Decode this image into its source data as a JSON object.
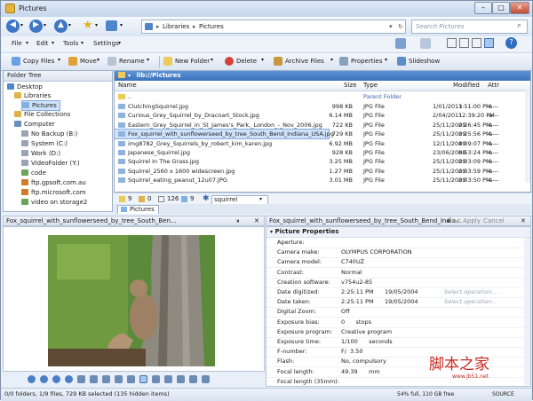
{
  "window": {
    "title": "Pictures",
    "minimize": "–",
    "maximize": "□",
    "close": "✕"
  },
  "nav": {
    "address": [
      "Libraries",
      "Pictures"
    ],
    "search_placeholder": "Search Pictures"
  },
  "menu": [
    "File",
    "Edit",
    "Tools",
    "Settings"
  ],
  "toolbar": [
    "Copy Files",
    "Move",
    "Rename",
    "New Folder",
    "Delete",
    "Archive Files",
    "Properties",
    "Slideshow"
  ],
  "folder_tree": {
    "header": "Folder Tree",
    "items": [
      "Desktop",
      "Libraries",
      "Pictures",
      "File Collections",
      "Computer",
      "No Backup (B:)",
      "System (C:)",
      "Work (D:)",
      "VideoFolder (Y:)",
      "code",
      "ftp.gpsoft.com.au",
      "ftp.microsoft.com",
      "video on storage2"
    ]
  },
  "lister": {
    "path": "lib://Pictures",
    "columns": {
      "name": "Name",
      "size": "Size",
      "type": "Type",
      "modified": "Modified",
      "attr": "Attr"
    },
    "parent": {
      "name": "..",
      "type": "Parent Folder"
    },
    "files": [
      {
        "name": "ClutchingSquirrel.jpg",
        "size": "998 KB",
        "type": "JPG File",
        "date": "1/01/2011",
        "time": "3:51:00 PM",
        "attr": "-a---"
      },
      {
        "name": "Curious_Grey_Squirrel_by_Dracoart_Stock.jpg",
        "size": "6.14 MB",
        "type": "JPG File",
        "date": "2/04/2011",
        "time": "12:39:20 PM",
        "attr": "-a---"
      },
      {
        "name": "Eastern_Grey_Squirrel_in_St_James's_Park,_London_-_Nov_2006.jpg",
        "size": "722 KB",
        "type": "JPG File",
        "date": "25/11/2009",
        "time": "2:26:45 PM",
        "attr": "-a---"
      },
      {
        "name": "Fox_squirrel_with_sunflowerseed_by_tree_South_Bend_Indiana_USA.jpg",
        "size": "729 KB",
        "type": "JPG File",
        "date": "25/11/2009",
        "time": "2:25:56 PM",
        "attr": "-a---"
      },
      {
        "name": "img8782_Grey_Squirrels_by_robert_kim_karen.jpg",
        "size": "6.92 MB",
        "type": "JPG File",
        "date": "12/11/2009",
        "time": "4:09:07 PM",
        "attr": "-a---"
      },
      {
        "name": "Japanese_Squirrel.jpg",
        "size": "928 KB",
        "type": "JPG File",
        "date": "23/06/2008",
        "time": "8:53:24 PM",
        "attr": "-a---"
      },
      {
        "name": "Squirrel In The Grass.jpg",
        "size": "3.25 MB",
        "type": "JPG File",
        "date": "25/11/2009",
        "time": "2:03:09 PM",
        "attr": "-a---"
      },
      {
        "name": "Squirrel_2560 x 1600 widescreen.jpg",
        "size": "1.27 MB",
        "type": "JPG File",
        "date": "25/11/2009",
        "time": "2:03:59 PM",
        "attr": "-a---"
      },
      {
        "name": "Squirrel_eating_peanut_12u07.JPG",
        "size": "3.01 MB",
        "type": "JPG File",
        "date": "25/11/2009",
        "time": "2:03:50 PM",
        "attr": "-a---"
      }
    ],
    "filter": {
      "c1": "9",
      "c2": "0",
      "c3": "126",
      "c4": "9",
      "text": "squirrel"
    },
    "tab": "Pictures"
  },
  "viewer": {
    "title": "Fox_squirrel_with_sunflowerseed_by_tree_South_Ben..."
  },
  "metadata": {
    "title": "Fox_squirrel_with_sunflowerseed_by_tree_South_Bend_India...",
    "apply": "Apply",
    "cancel": "Cancel",
    "section": "Picture Properties",
    "props": [
      {
        "k": "Aperture:",
        "v": ""
      },
      {
        "k": "Camera make:",
        "v": "OLYMPUS CORPORATION"
      },
      {
        "k": "Camera model:",
        "v": "C740UZ"
      },
      {
        "k": "Contrast:",
        "v": "Normal"
      },
      {
        "k": "Creation software:",
        "v": "v754u2-85"
      },
      {
        "k": "Date digitized:",
        "v": "2:25:11 PM      19/05/2004",
        "hint": "Select operation..."
      },
      {
        "k": "Date taken:",
        "v": "2:25:11 PM      19/05/2004",
        "hint": "Select operation..."
      },
      {
        "k": "Digital Zoom:",
        "v": "Off"
      },
      {
        "k": "Exposure bias:",
        "v": "0      stops"
      },
      {
        "k": "Exposure program:",
        "v": "Creative program"
      },
      {
        "k": "Exposure time:",
        "v": "1/100      seconds"
      },
      {
        "k": "F-number:",
        "v": "F/  3.50"
      },
      {
        "k": "Flash:",
        "v": "No, compulsory"
      },
      {
        "k": "Focal length:",
        "v": "49.39      mm"
      },
      {
        "k": "Focal length (35mm):",
        "v": ""
      }
    ]
  },
  "status": {
    "left": "0/0 folders, 1/9 files, 729 KB selected (135 hidden items)",
    "free": "54% full, 110 GB free",
    "source": "SOURCE"
  },
  "watermark": {
    "cn": "脚本之家",
    "url": "www.jb51.net"
  }
}
